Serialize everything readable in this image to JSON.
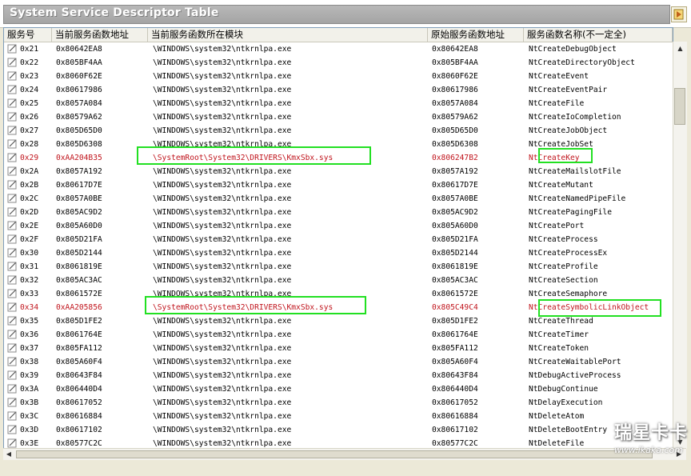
{
  "window": {
    "title": "System Service Descriptor Table",
    "help_icon": "help-book-icon"
  },
  "table": {
    "columns": [
      {
        "label": "服务号"
      },
      {
        "label": "当前服务函数地址"
      },
      {
        "label": "当前服务函数所在模块"
      },
      {
        "label": "原始服务函数地址"
      },
      {
        "label": "服务函数名称(不一定全)"
      }
    ],
    "colors": {
      "normal": "#000000",
      "hooked": "#c0141c",
      "highlight": "#22e022"
    },
    "rows": [
      {
        "id": "0x21",
        "cur": "0x80642EA8",
        "module": "\\WINDOWS\\system32\\ntkrnlpa.exe",
        "orig": "0x80642EA8",
        "name": "NtCreateDebugObject",
        "hooked": false
      },
      {
        "id": "0x22",
        "cur": "0x805BF4AA",
        "module": "\\WINDOWS\\system32\\ntkrnlpa.exe",
        "orig": "0x805BF4AA",
        "name": "NtCreateDirectoryObject",
        "hooked": false
      },
      {
        "id": "0x23",
        "cur": "0x8060F62E",
        "module": "\\WINDOWS\\system32\\ntkrnlpa.exe",
        "orig": "0x8060F62E",
        "name": "NtCreateEvent",
        "hooked": false
      },
      {
        "id": "0x24",
        "cur": "0x80617986",
        "module": "\\WINDOWS\\system32\\ntkrnlpa.exe",
        "orig": "0x80617986",
        "name": "NtCreateEventPair",
        "hooked": false
      },
      {
        "id": "0x25",
        "cur": "0x8057A084",
        "module": "\\WINDOWS\\system32\\ntkrnlpa.exe",
        "orig": "0x8057A084",
        "name": "NtCreateFile",
        "hooked": false
      },
      {
        "id": "0x26",
        "cur": "0x80579A62",
        "module": "\\WINDOWS\\system32\\ntkrnlpa.exe",
        "orig": "0x80579A62",
        "name": "NtCreateIoCompletion",
        "hooked": false
      },
      {
        "id": "0x27",
        "cur": "0x805D65D0",
        "module": "\\WINDOWS\\system32\\ntkrnlpa.exe",
        "orig": "0x805D65D0",
        "name": "NtCreateJobObject",
        "hooked": false
      },
      {
        "id": "0x28",
        "cur": "0x805D6308",
        "module": "\\WINDOWS\\system32\\ntkrnlpa.exe",
        "orig": "0x805D6308",
        "name": "NtCreateJobSet",
        "hooked": false
      },
      {
        "id": "0x29",
        "cur": "0xAA204B35",
        "module": "\\SystemRoot\\System32\\DRIVERS\\KmxSbx.sys",
        "orig": "0x806247B2",
        "name": "NtCreateKey",
        "hooked": true
      },
      {
        "id": "0x2A",
        "cur": "0x8057A192",
        "module": "\\WINDOWS\\system32\\ntkrnlpa.exe",
        "orig": "0x8057A192",
        "name": "NtCreateMailslotFile",
        "hooked": false
      },
      {
        "id": "0x2B",
        "cur": "0x80617D7E",
        "module": "\\WINDOWS\\system32\\ntkrnlpa.exe",
        "orig": "0x80617D7E",
        "name": "NtCreateMutant",
        "hooked": false
      },
      {
        "id": "0x2C",
        "cur": "0x8057A0BE",
        "module": "\\WINDOWS\\system32\\ntkrnlpa.exe",
        "orig": "0x8057A0BE",
        "name": "NtCreateNamedPipeFile",
        "hooked": false
      },
      {
        "id": "0x2D",
        "cur": "0x805AC9D2",
        "module": "\\WINDOWS\\system32\\ntkrnlpa.exe",
        "orig": "0x805AC9D2",
        "name": "NtCreatePagingFile",
        "hooked": false
      },
      {
        "id": "0x2E",
        "cur": "0x805A60D0",
        "module": "\\WINDOWS\\system32\\ntkrnlpa.exe",
        "orig": "0x805A60D0",
        "name": "NtCreatePort",
        "hooked": false
      },
      {
        "id": "0x2F",
        "cur": "0x805D21FA",
        "module": "\\WINDOWS\\system32\\ntkrnlpa.exe",
        "orig": "0x805D21FA",
        "name": "NtCreateProcess",
        "hooked": false
      },
      {
        "id": "0x30",
        "cur": "0x805D2144",
        "module": "\\WINDOWS\\system32\\ntkrnlpa.exe",
        "orig": "0x805D2144",
        "name": "NtCreateProcessEx",
        "hooked": false
      },
      {
        "id": "0x31",
        "cur": "0x8061819E",
        "module": "\\WINDOWS\\system32\\ntkrnlpa.exe",
        "orig": "0x8061819E",
        "name": "NtCreateProfile",
        "hooked": false
      },
      {
        "id": "0x32",
        "cur": "0x805AC3AC",
        "module": "\\WINDOWS\\system32\\ntkrnlpa.exe",
        "orig": "0x805AC3AC",
        "name": "NtCreateSection",
        "hooked": false
      },
      {
        "id": "0x33",
        "cur": "0x8061572E",
        "module": "\\WINDOWS\\system32\\ntkrnlpa.exe",
        "orig": "0x8061572E",
        "name": "NtCreateSemaphore",
        "hooked": false
      },
      {
        "id": "0x34",
        "cur": "0xAA205856",
        "module": "\\SystemRoot\\System32\\DRIVERS\\KmxSbx.sys",
        "orig": "0x805C49C4",
        "name": "NtCreateSymbolicLinkObject",
        "hooked": true
      },
      {
        "id": "0x35",
        "cur": "0x805D1FE2",
        "module": "\\WINDOWS\\system32\\ntkrnlpa.exe",
        "orig": "0x805D1FE2",
        "name": "NtCreateThread",
        "hooked": false
      },
      {
        "id": "0x36",
        "cur": "0x8061764E",
        "module": "\\WINDOWS\\system32\\ntkrnlpa.exe",
        "orig": "0x8061764E",
        "name": "NtCreateTimer",
        "hooked": false
      },
      {
        "id": "0x37",
        "cur": "0x805FA112",
        "module": "\\WINDOWS\\system32\\ntkrnlpa.exe",
        "orig": "0x805FA112",
        "name": "NtCreateToken",
        "hooked": false
      },
      {
        "id": "0x38",
        "cur": "0x805A60F4",
        "module": "\\WINDOWS\\system32\\ntkrnlpa.exe",
        "orig": "0x805A60F4",
        "name": "NtCreateWaitablePort",
        "hooked": false
      },
      {
        "id": "0x39",
        "cur": "0x80643F84",
        "module": "\\WINDOWS\\system32\\ntkrnlpa.exe",
        "orig": "0x80643F84",
        "name": "NtDebugActiveProcess",
        "hooked": false
      },
      {
        "id": "0x3A",
        "cur": "0x806440D4",
        "module": "\\WINDOWS\\system32\\ntkrnlpa.exe",
        "orig": "0x806440D4",
        "name": "NtDebugContinue",
        "hooked": false
      },
      {
        "id": "0x3B",
        "cur": "0x80617052",
        "module": "\\WINDOWS\\system32\\ntkrnlpa.exe",
        "orig": "0x80617052",
        "name": "NtDelayExecution",
        "hooked": false
      },
      {
        "id": "0x3C",
        "cur": "0x80616884",
        "module": "\\WINDOWS\\system32\\ntkrnlpa.exe",
        "orig": "0x80616884",
        "name": "NtDeleteAtom",
        "hooked": false
      },
      {
        "id": "0x3D",
        "cur": "0x80617102",
        "module": "\\WINDOWS\\system32\\ntkrnlpa.exe",
        "orig": "0x80617102",
        "name": "NtDeleteBootEntry",
        "hooked": false
      },
      {
        "id": "0x3E",
        "cur": "0x80577C2C",
        "module": "\\WINDOWS\\system32\\ntkrnlpa.exe",
        "orig": "0x80577C2C",
        "name": "NtDeleteFile",
        "hooked": false
      }
    ]
  },
  "scrollbars": {
    "up_icon": "scroll-up-icon",
    "down_icon": "scroll-down-icon",
    "left_icon": "scroll-left-icon",
    "right_icon": "scroll-right-icon"
  },
  "watermark": {
    "logo": "瑞星卡卡",
    "url": "www.ikaka.com"
  }
}
